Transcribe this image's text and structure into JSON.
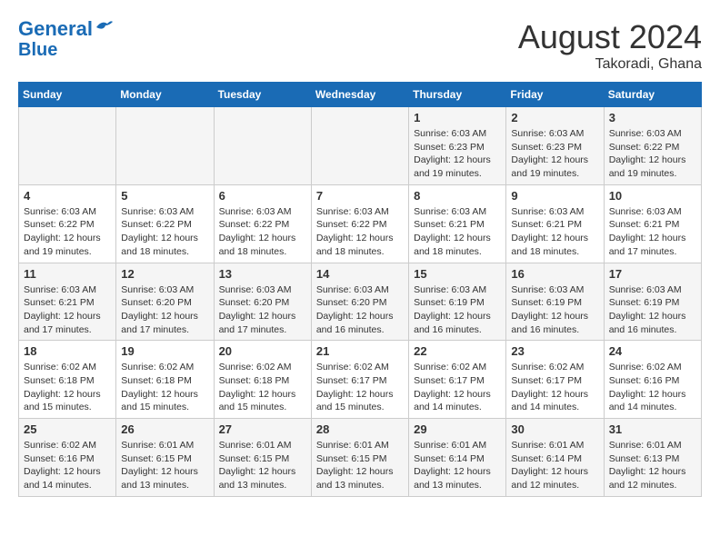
{
  "header": {
    "logo_line1": "General",
    "logo_line2": "Blue",
    "main_title": "August 2024",
    "subtitle": "Takoradi, Ghana"
  },
  "weekdays": [
    "Sunday",
    "Monday",
    "Tuesday",
    "Wednesday",
    "Thursday",
    "Friday",
    "Saturday"
  ],
  "weeks": [
    {
      "row_bg": "odd",
      "days": [
        {
          "num": "",
          "info": ""
        },
        {
          "num": "",
          "info": ""
        },
        {
          "num": "",
          "info": ""
        },
        {
          "num": "",
          "info": ""
        },
        {
          "num": "1",
          "info": "Sunrise: 6:03 AM\nSunset: 6:23 PM\nDaylight: 12 hours\nand 19 minutes."
        },
        {
          "num": "2",
          "info": "Sunrise: 6:03 AM\nSunset: 6:23 PM\nDaylight: 12 hours\nand 19 minutes."
        },
        {
          "num": "3",
          "info": "Sunrise: 6:03 AM\nSunset: 6:22 PM\nDaylight: 12 hours\nand 19 minutes."
        }
      ]
    },
    {
      "row_bg": "even",
      "days": [
        {
          "num": "4",
          "info": "Sunrise: 6:03 AM\nSunset: 6:22 PM\nDaylight: 12 hours\nand 19 minutes."
        },
        {
          "num": "5",
          "info": "Sunrise: 6:03 AM\nSunset: 6:22 PM\nDaylight: 12 hours\nand 18 minutes."
        },
        {
          "num": "6",
          "info": "Sunrise: 6:03 AM\nSunset: 6:22 PM\nDaylight: 12 hours\nand 18 minutes."
        },
        {
          "num": "7",
          "info": "Sunrise: 6:03 AM\nSunset: 6:22 PM\nDaylight: 12 hours\nand 18 minutes."
        },
        {
          "num": "8",
          "info": "Sunrise: 6:03 AM\nSunset: 6:21 PM\nDaylight: 12 hours\nand 18 minutes."
        },
        {
          "num": "9",
          "info": "Sunrise: 6:03 AM\nSunset: 6:21 PM\nDaylight: 12 hours\nand 18 minutes."
        },
        {
          "num": "10",
          "info": "Sunrise: 6:03 AM\nSunset: 6:21 PM\nDaylight: 12 hours\nand 17 minutes."
        }
      ]
    },
    {
      "row_bg": "odd",
      "days": [
        {
          "num": "11",
          "info": "Sunrise: 6:03 AM\nSunset: 6:21 PM\nDaylight: 12 hours\nand 17 minutes."
        },
        {
          "num": "12",
          "info": "Sunrise: 6:03 AM\nSunset: 6:20 PM\nDaylight: 12 hours\nand 17 minutes."
        },
        {
          "num": "13",
          "info": "Sunrise: 6:03 AM\nSunset: 6:20 PM\nDaylight: 12 hours\nand 17 minutes."
        },
        {
          "num": "14",
          "info": "Sunrise: 6:03 AM\nSunset: 6:20 PM\nDaylight: 12 hours\nand 16 minutes."
        },
        {
          "num": "15",
          "info": "Sunrise: 6:03 AM\nSunset: 6:19 PM\nDaylight: 12 hours\nand 16 minutes."
        },
        {
          "num": "16",
          "info": "Sunrise: 6:03 AM\nSunset: 6:19 PM\nDaylight: 12 hours\nand 16 minutes."
        },
        {
          "num": "17",
          "info": "Sunrise: 6:03 AM\nSunset: 6:19 PM\nDaylight: 12 hours\nand 16 minutes."
        }
      ]
    },
    {
      "row_bg": "even",
      "days": [
        {
          "num": "18",
          "info": "Sunrise: 6:02 AM\nSunset: 6:18 PM\nDaylight: 12 hours\nand 15 minutes."
        },
        {
          "num": "19",
          "info": "Sunrise: 6:02 AM\nSunset: 6:18 PM\nDaylight: 12 hours\nand 15 minutes."
        },
        {
          "num": "20",
          "info": "Sunrise: 6:02 AM\nSunset: 6:18 PM\nDaylight: 12 hours\nand 15 minutes."
        },
        {
          "num": "21",
          "info": "Sunrise: 6:02 AM\nSunset: 6:17 PM\nDaylight: 12 hours\nand 15 minutes."
        },
        {
          "num": "22",
          "info": "Sunrise: 6:02 AM\nSunset: 6:17 PM\nDaylight: 12 hours\nand 14 minutes."
        },
        {
          "num": "23",
          "info": "Sunrise: 6:02 AM\nSunset: 6:17 PM\nDaylight: 12 hours\nand 14 minutes."
        },
        {
          "num": "24",
          "info": "Sunrise: 6:02 AM\nSunset: 6:16 PM\nDaylight: 12 hours\nand 14 minutes."
        }
      ]
    },
    {
      "row_bg": "odd",
      "days": [
        {
          "num": "25",
          "info": "Sunrise: 6:02 AM\nSunset: 6:16 PM\nDaylight: 12 hours\nand 14 minutes."
        },
        {
          "num": "26",
          "info": "Sunrise: 6:01 AM\nSunset: 6:15 PM\nDaylight: 12 hours\nand 13 minutes."
        },
        {
          "num": "27",
          "info": "Sunrise: 6:01 AM\nSunset: 6:15 PM\nDaylight: 12 hours\nand 13 minutes."
        },
        {
          "num": "28",
          "info": "Sunrise: 6:01 AM\nSunset: 6:15 PM\nDaylight: 12 hours\nand 13 minutes."
        },
        {
          "num": "29",
          "info": "Sunrise: 6:01 AM\nSunset: 6:14 PM\nDaylight: 12 hours\nand 13 minutes."
        },
        {
          "num": "30",
          "info": "Sunrise: 6:01 AM\nSunset: 6:14 PM\nDaylight: 12 hours\nand 12 minutes."
        },
        {
          "num": "31",
          "info": "Sunrise: 6:01 AM\nSunset: 6:13 PM\nDaylight: 12 hours\nand 12 minutes."
        }
      ]
    }
  ]
}
